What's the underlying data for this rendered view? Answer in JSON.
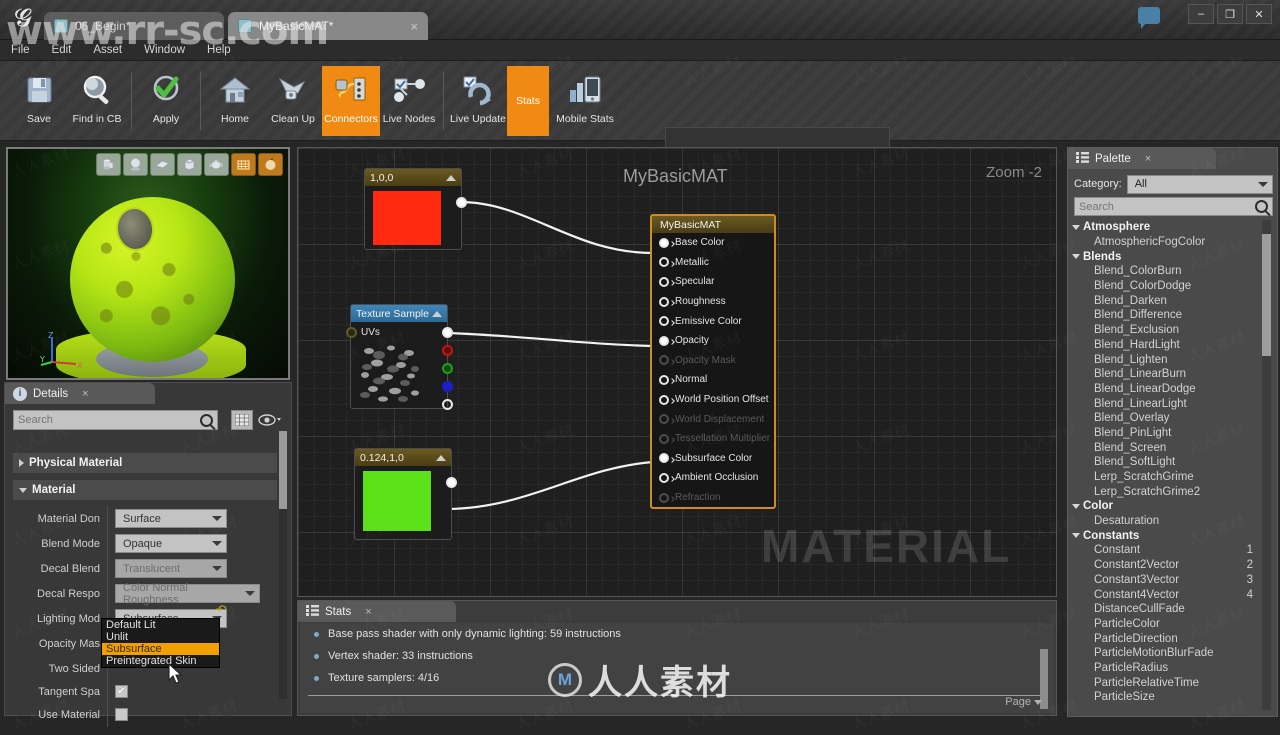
{
  "watermarks": {
    "top": "www.rr-sc.com",
    "center": "人人素材",
    "material": "MATERIAL",
    "tile": "人人素材"
  },
  "titlebar": {
    "tabs": [
      {
        "label": "06_Begin*",
        "icon": "document-icon"
      },
      {
        "label": "MyBasicMAT*",
        "icon": "material-icon"
      }
    ],
    "close_glyph": "×",
    "window": {
      "minimize": "–",
      "maximize": "❐",
      "close": "✕"
    }
  },
  "menubar": {
    "items": [
      "File",
      "Edit",
      "Asset",
      "Window",
      "Help"
    ]
  },
  "toolbar": {
    "buttons": [
      {
        "label": "Save",
        "icon": "save-icon",
        "active": false
      },
      {
        "label": "Find in CB",
        "icon": "find-icon",
        "active": false
      },
      {
        "label": "Apply",
        "icon": "apply-check-icon",
        "active": false
      },
      {
        "label": "Home",
        "icon": "home-icon",
        "active": false
      },
      {
        "label": "Clean Up",
        "icon": "cleanup-icon",
        "active": false
      },
      {
        "label": "Connectors",
        "icon": "connectors-icon",
        "active": true
      },
      {
        "label": "Live Nodes",
        "icon": "live-nodes-icon",
        "active": false
      },
      {
        "label": "Live Update",
        "icon": "live-update-icon",
        "active": false
      },
      {
        "label": "Stats",
        "icon": "stats-text-icon",
        "active": true
      },
      {
        "label": "Mobile Stats",
        "icon": "mobile-stats-icon",
        "active": false
      }
    ],
    "search": {
      "placeholder": "Search",
      "value": ""
    }
  },
  "viewport": {
    "shape_buttons": [
      "cylinder-icon",
      "sphere-icon",
      "plane-icon",
      "cube-icon",
      "teapot-icon",
      "grid-icon",
      "preview-material-icon"
    ],
    "axis": {
      "x": "X",
      "y": "Y",
      "z": "Z"
    }
  },
  "details": {
    "tab": {
      "title": "Details",
      "icon": "info-icon",
      "close": "×"
    },
    "search": {
      "placeholder": "Search",
      "value": ""
    },
    "buttons": [
      "grid-view-icon",
      "eye-icon"
    ],
    "sections": [
      {
        "name": "Physical Material",
        "open": false
      },
      {
        "name": "Material",
        "open": true
      }
    ],
    "properties": [
      {
        "label": "Material Don",
        "value": "Surface",
        "type": "combo",
        "disabled": false
      },
      {
        "label": "Blend Mode",
        "value": "Opaque",
        "type": "combo",
        "disabled": false
      },
      {
        "label": "Decal Blend",
        "value": "Translucent",
        "type": "combo",
        "disabled": true
      },
      {
        "label": "Decal Respo",
        "value": "Color Normal Roughness",
        "type": "combo",
        "disabled": true
      },
      {
        "label": "Lighting Mod",
        "value": "Subsurface",
        "type": "combo",
        "disabled": false
      },
      {
        "label": "Opacity Mas",
        "value": "",
        "type": "blank",
        "disabled": false
      },
      {
        "label": "Two Sided",
        "value": "",
        "type": "blank",
        "disabled": false
      },
      {
        "label": "Tangent Spa",
        "value": "",
        "type": "checkbox",
        "checked": true
      },
      {
        "label": "Use Material",
        "value": "",
        "type": "checkbox",
        "checked": false
      }
    ],
    "lighting_dropdown": {
      "open": true,
      "selected": "Subsurface",
      "options": [
        "Default Lit",
        "Unlit",
        "Subsurface",
        "Preintegrated Skin"
      ]
    },
    "revert_icon": "revert-arrow-icon"
  },
  "graph": {
    "title": "MyBasicMAT",
    "zoom_label": "Zoom -2",
    "nodes": [
      {
        "name": "constant-red",
        "title": "1,0,0",
        "color": "#ff2a0f",
        "type": "color"
      },
      {
        "name": "texture-sample",
        "title": "Texture Sample",
        "type": "texture",
        "input_pin": "UVs"
      },
      {
        "name": "constant-green",
        "title": "0.124,1,0",
        "color": "#5ce017",
        "type": "color"
      }
    ],
    "material_node": {
      "title": "MyBasicMAT",
      "pins": [
        {
          "label": "Base Color",
          "connected": true,
          "disabled": false
        },
        {
          "label": "Metallic",
          "connected": false,
          "disabled": false
        },
        {
          "label": "Specular",
          "connected": false,
          "disabled": false
        },
        {
          "label": "Roughness",
          "connected": false,
          "disabled": false
        },
        {
          "label": "Emissive Color",
          "connected": false,
          "disabled": false
        },
        {
          "label": "Opacity",
          "connected": true,
          "disabled": false
        },
        {
          "label": "Opacity Mask",
          "connected": false,
          "disabled": true
        },
        {
          "label": "Normal",
          "connected": false,
          "disabled": false
        },
        {
          "label": "World Position Offset",
          "connected": false,
          "disabled": false
        },
        {
          "label": "World Displacement",
          "connected": false,
          "disabled": true
        },
        {
          "label": "Tessellation Multiplier",
          "connected": false,
          "disabled": true
        },
        {
          "label": "Subsurface Color",
          "connected": true,
          "disabled": false
        },
        {
          "label": "Ambient Occlusion",
          "connected": false,
          "disabled": false
        },
        {
          "label": "Refraction",
          "connected": false,
          "disabled": true
        }
      ]
    }
  },
  "stats": {
    "tab": {
      "title": "Stats",
      "icon": "list-icon",
      "close": "×"
    },
    "rows": [
      "Base pass shader with only dynamic lighting: 59 instructions",
      "Vertex shader: 33 instructions",
      "Texture samplers: 4/16"
    ],
    "page_label": "Page"
  },
  "palette": {
    "tab": {
      "title": "Palette",
      "icon": "list-icon",
      "close": "×"
    },
    "category": {
      "label": "Category:",
      "value": "All"
    },
    "search": {
      "placeholder": "Search",
      "value": ""
    },
    "groups": [
      {
        "name": "Atmosphere",
        "items": [
          {
            "label": "AtmosphericFogColor",
            "num": ""
          }
        ]
      },
      {
        "name": "Blends",
        "items": [
          {
            "label": "Blend_ColorBurn",
            "num": ""
          },
          {
            "label": "Blend_ColorDodge",
            "num": ""
          },
          {
            "label": "Blend_Darken",
            "num": ""
          },
          {
            "label": "Blend_Difference",
            "num": ""
          },
          {
            "label": "Blend_Exclusion",
            "num": ""
          },
          {
            "label": "Blend_HardLight",
            "num": ""
          },
          {
            "label": "Blend_Lighten",
            "num": ""
          },
          {
            "label": "Blend_LinearBurn",
            "num": ""
          },
          {
            "label": "Blend_LinearDodge",
            "num": ""
          },
          {
            "label": "Blend_LinearLight",
            "num": ""
          },
          {
            "label": "Blend_Overlay",
            "num": ""
          },
          {
            "label": "Blend_PinLight",
            "num": ""
          },
          {
            "label": "Blend_Screen",
            "num": ""
          },
          {
            "label": "Blend_SoftLight",
            "num": ""
          },
          {
            "label": "Lerp_ScratchGrime",
            "num": ""
          },
          {
            "label": "Lerp_ScratchGrime2",
            "num": ""
          }
        ]
      },
      {
        "name": "Color",
        "items": [
          {
            "label": "Desaturation",
            "num": ""
          }
        ]
      },
      {
        "name": "Constants",
        "items": [
          {
            "label": "Constant",
            "num": "1"
          },
          {
            "label": "Constant2Vector",
            "num": "2"
          },
          {
            "label": "Constant3Vector",
            "num": "3"
          },
          {
            "label": "Constant4Vector",
            "num": "4"
          },
          {
            "label": "DistanceCullFade",
            "num": ""
          },
          {
            "label": "ParticleColor",
            "num": ""
          },
          {
            "label": "ParticleDirection",
            "num": ""
          },
          {
            "label": "ParticleMotionBlurFade",
            "num": ""
          },
          {
            "label": "ParticleRadius",
            "num": ""
          },
          {
            "label": "ParticleRelativeTime",
            "num": ""
          },
          {
            "label": "ParticleSize",
            "num": ""
          }
        ]
      }
    ]
  },
  "colors": {
    "accent": "#f08a12",
    "selection": "#f0a000",
    "node_border": "#d08b22"
  }
}
